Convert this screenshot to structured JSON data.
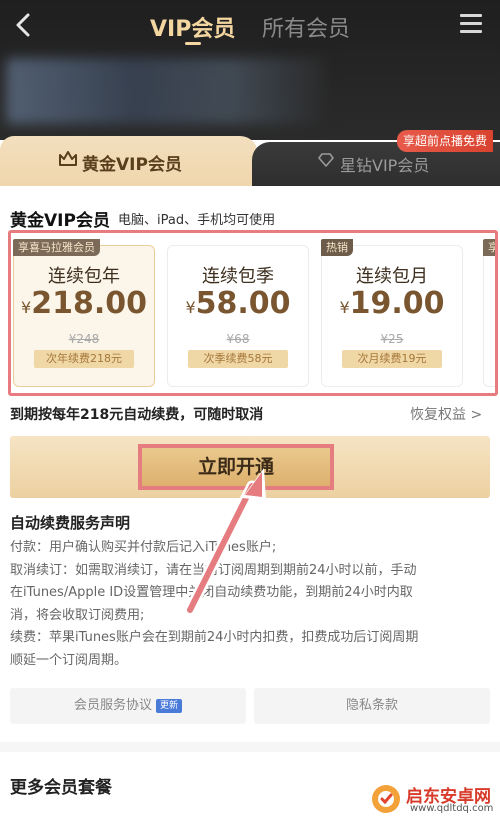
{
  "nav": {
    "tab_vip": "VIP会员",
    "tab_all": "所有会员"
  },
  "tabs": {
    "gold_label": "黄金VIP会员",
    "star_label": "星钻VIP会员",
    "free_badge": "享超前点播免费"
  },
  "plan": {
    "title": "黄金VIP会员",
    "subtitle": "电脑、iPad、手机均可使用",
    "cards": [
      {
        "tag": "享喜马拉雅会员",
        "name": "连续包年",
        "currency": "¥",
        "price": "218.00",
        "old": "¥248",
        "renew": "次年续费218元",
        "selected": true
      },
      {
        "tag": "",
        "name": "连续包季",
        "currency": "¥",
        "price": "58.00",
        "old": "¥68",
        "renew": "次季续费58元",
        "selected": false
      },
      {
        "tag": "热销",
        "name": "连续包月",
        "currency": "¥",
        "price": "19.00",
        "old": "¥25",
        "renew": "次月续费19元",
        "selected": false
      }
    ],
    "partial_tag": "享"
  },
  "auto_renew": {
    "text": "到期按每年218元自动续费，可随时取消",
    "restore": "恢复权益 >"
  },
  "buy": {
    "label": "立即开通"
  },
  "statement": {
    "title": "自动续费服务声明",
    "lines": [
      "付款：用户确认购买并付款后记入iTunes账户;",
      "取消续订：如需取消续订，请在当前订阅周期到期前24小时以前，手动",
      "在iTunes/Apple ID设置管理中关闭自动续费功能，到期前24小时内取",
      "消，将会收取订阅费用;",
      "续费：苹果iTunes账户会在到期前24小时内扣费，扣费成功后订阅周期",
      "顺延一个订阅周期。"
    ]
  },
  "links": {
    "agreement": "会员服务协议",
    "new_badge": "更新",
    "privacy": "隐私条款"
  },
  "more": {
    "title": "更多会员套餐"
  },
  "watermark": {
    "name": "启东安卓网",
    "url": "www.qdltdq.com"
  },
  "colors": {
    "gold": "#f4d6a0",
    "highlight": "#e57c80",
    "price": "#7a5630"
  }
}
